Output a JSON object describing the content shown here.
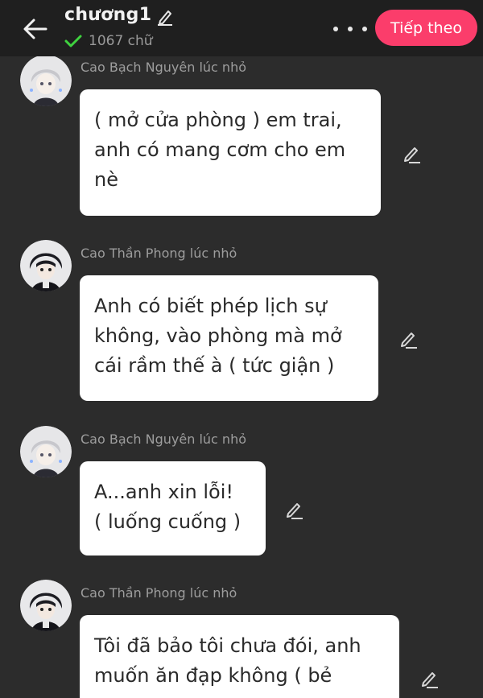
{
  "header": {
    "back_icon": "arrow-left-icon",
    "chapter_title": "chương1",
    "title_edit_icon": "pencil-icon",
    "check_icon": "checkmark-icon",
    "word_count": "1067 chữ",
    "more_icon": "more-horizontal-icon",
    "next_label": "Tiếp theo",
    "colors": {
      "header_bg": "#1f1f1f",
      "accent": "#fb3d6b",
      "check": "#3fd23f"
    }
  },
  "messages": [
    {
      "speaker": "Cao Bạch Nguyên lúc nhỏ",
      "avatar": "silver-hair-boy-avatar",
      "lines": [
        "( mở cửa phòng ) em trai,",
        "anh có mang cơm cho em",
        "nè"
      ]
    },
    {
      "speaker": "Cao Thần Phong lúc nhỏ",
      "avatar": "dark-hair-boy-avatar",
      "lines": [
        "Anh có biết phép lịch sự",
        "không, vào phòng mà mở",
        "cái rầm thế à ( tức giận )"
      ]
    },
    {
      "speaker": "Cao Bạch Nguyên lúc nhỏ",
      "avatar": "silver-hair-boy-avatar",
      "lines": [
        "A...anh xin lỗi!",
        "( luống cuống )"
      ]
    },
    {
      "speaker": "Cao Thần Phong lúc nhỏ",
      "avatar": "dark-hair-boy-avatar",
      "lines": [
        "Tôi đã bảo tôi chưa đói, anh",
        "muốn ăn đạp không ( bẻ"
      ]
    }
  ],
  "edit_icon": "pencil-icon",
  "colors": {
    "background": "#2c2c2c",
    "bubble": "#ffffff"
  }
}
